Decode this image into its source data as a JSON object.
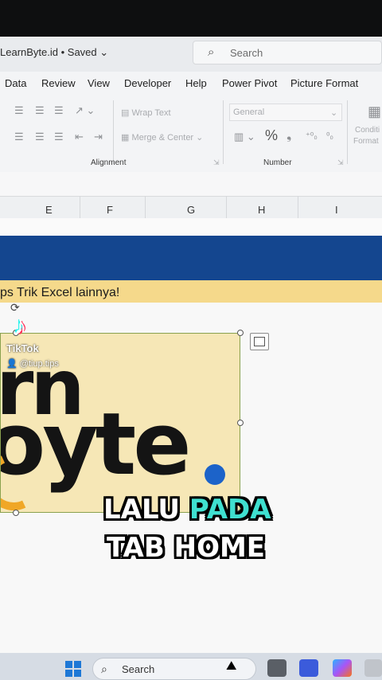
{
  "window": {
    "doc_title": "LearnByte.id • Saved",
    "search_placeholder": "Search"
  },
  "menu": [
    "Data",
    "Review",
    "View",
    "Developer",
    "Help",
    "Power Pivot",
    "Picture Format"
  ],
  "ribbon": {
    "wrap_text": "Wrap Text",
    "merge_center": "Merge & Center",
    "number_format": "General",
    "percent": "%",
    "conditional_line1": "Conditi",
    "conditional_line2": "Format",
    "group_alignment": "Alignment",
    "group_number": "Number"
  },
  "columns": [
    "E",
    "F",
    "G",
    "H",
    "I"
  ],
  "sheet": {
    "banner_text": "ps Trik Excel lainnya!",
    "logo_line1": "rn",
    "logo_line2": "oyte"
  },
  "watermark": {
    "brand": "TikTok",
    "handle": "@tiup.tips"
  },
  "caption": {
    "line1_part1": "LALU",
    "line1_part2": "PADA",
    "line2": "TAB HOME",
    "highlight_color": "#3fe0d0"
  },
  "taskbar": {
    "search_label": "Search"
  }
}
